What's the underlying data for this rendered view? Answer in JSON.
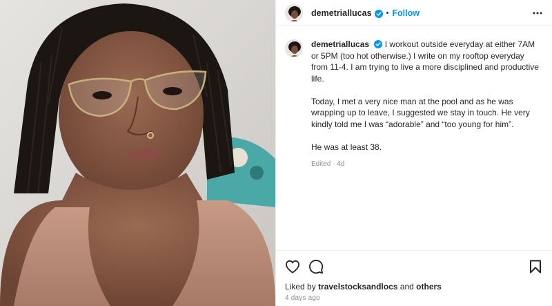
{
  "post": {
    "username": "demetriallucas",
    "follow_label": "Follow",
    "separator": "•",
    "caption": {
      "username": "demetriallucas",
      "paragraph_1": "I workout outside everyday at either 7AM or 5PM (too hot otherwise.) I write on my rooftop everyday from 11-4. I am trying to live a more disciplined and productive life.",
      "paragraph_2": "Today, I met a very nice man at the pool and as he was wrapping up to leave, I suggested we stay in touch. He very kindly told me I was “adorable” and “too young for him”.",
      "paragraph_3": "He was at least 38.",
      "edited": "Edited · 4d"
    },
    "likes": {
      "prefix": "Liked by",
      "user": "travelstocksandlocs",
      "joiner": "and",
      "others": "others"
    },
    "timestamp": "4 days ago"
  },
  "icons": {
    "verified": "verified-badge-icon",
    "more": "more-options-icon",
    "like": "heart-icon",
    "comment": "comment-bubble-icon",
    "save": "bookmark-icon"
  },
  "colors": {
    "follow": "#0095f6",
    "verified": "#0095f6",
    "text": "#262626",
    "muted": "#8e8e8e",
    "divider": "#efefef"
  }
}
